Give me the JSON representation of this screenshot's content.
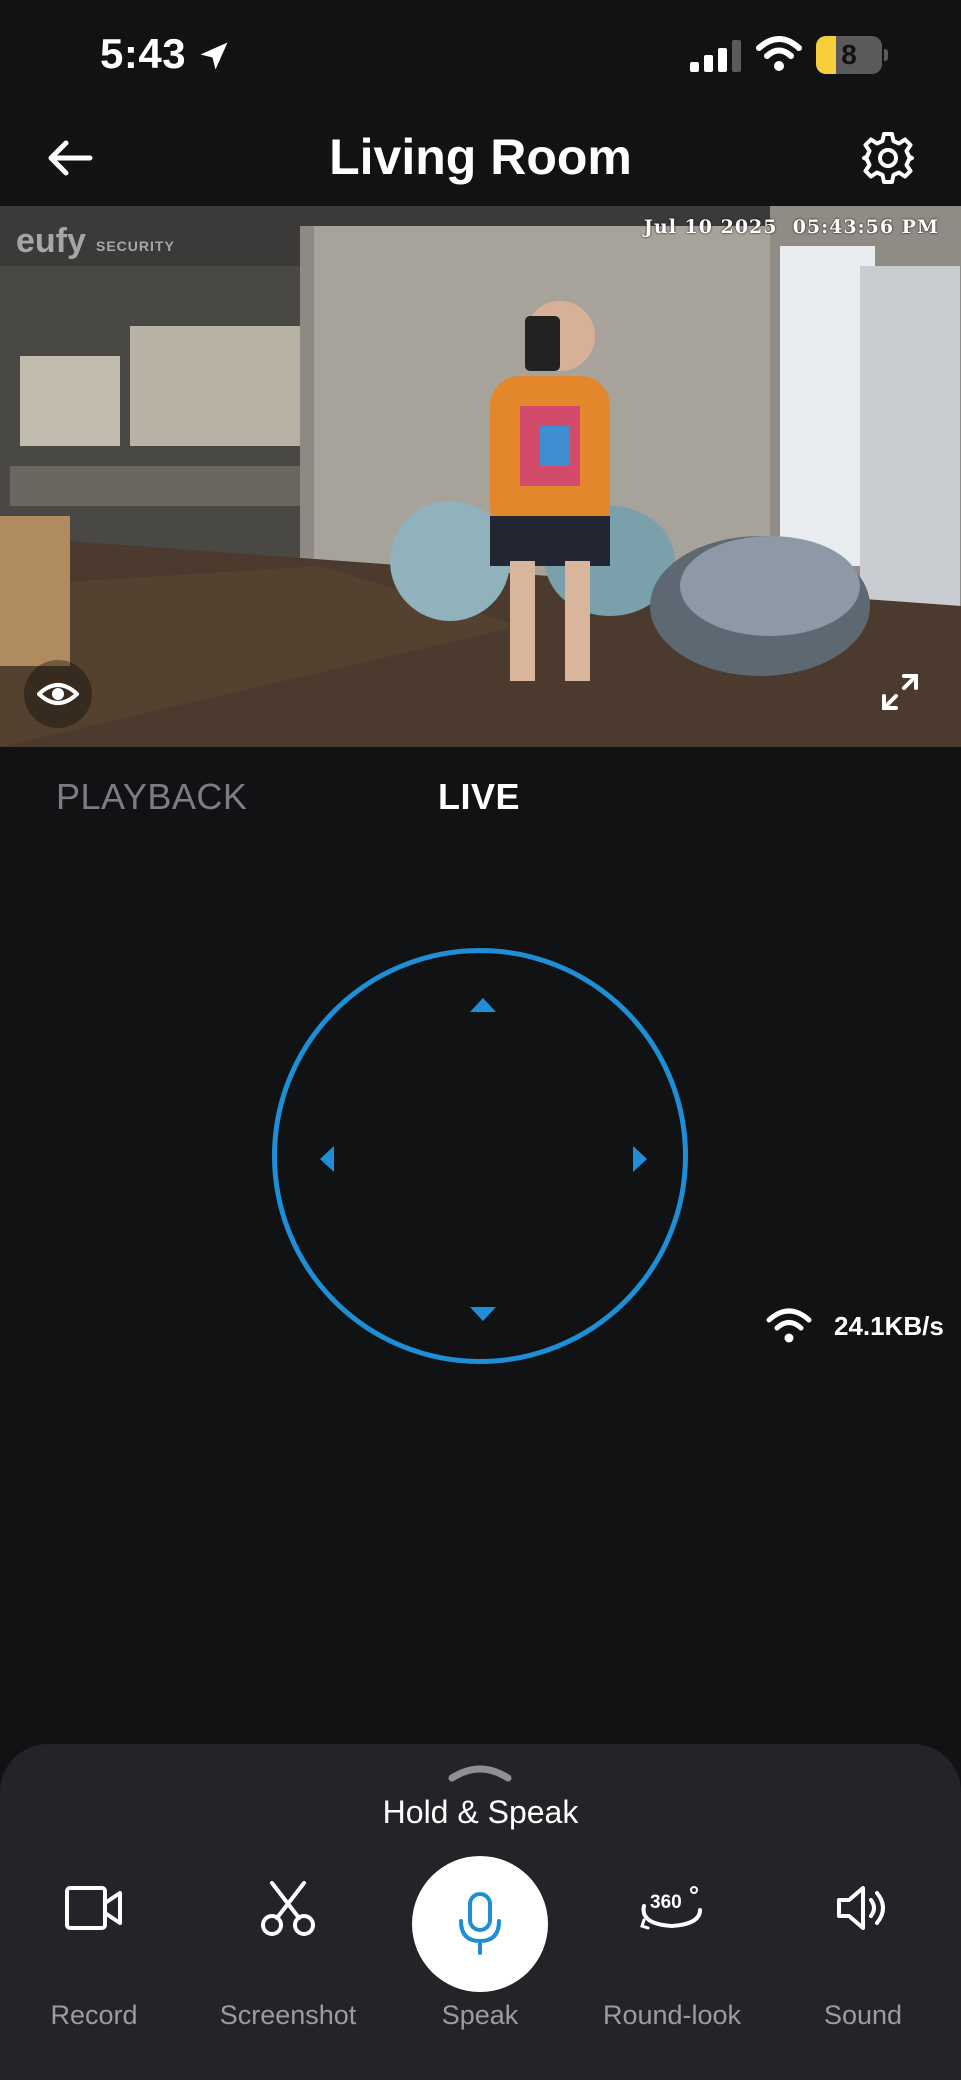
{
  "status_bar": {
    "time": "5:43",
    "battery_level": "8",
    "battery_fraction": 0.08
  },
  "header": {
    "title": "Living Room",
    "back_icon": "arrow-left-icon",
    "settings_icon": "gear-icon"
  },
  "camera": {
    "brand": "eufy",
    "brand_sub": "SECURITY",
    "timestamp": "Jul 10 2025  05:43:56 PM"
  },
  "tabs": {
    "playback": "PLAYBACK",
    "live": "LIVE",
    "active": "LIVE"
  },
  "ptz": {
    "accent_color": "#1e8fd6"
  },
  "network": {
    "bitrate": "24.1KB/s"
  },
  "bottom_panel": {
    "hold_speak": "Hold & Speak",
    "actions": [
      {
        "label": "Record",
        "icon": "video-camera-icon"
      },
      {
        "label": "Screenshot",
        "icon": "scissors-icon"
      },
      {
        "label": "Speak",
        "icon": "microphone-icon"
      },
      {
        "label": "Round-look",
        "icon": "rotate-360-icon"
      },
      {
        "label": "Sound",
        "icon": "speaker-icon"
      }
    ]
  }
}
